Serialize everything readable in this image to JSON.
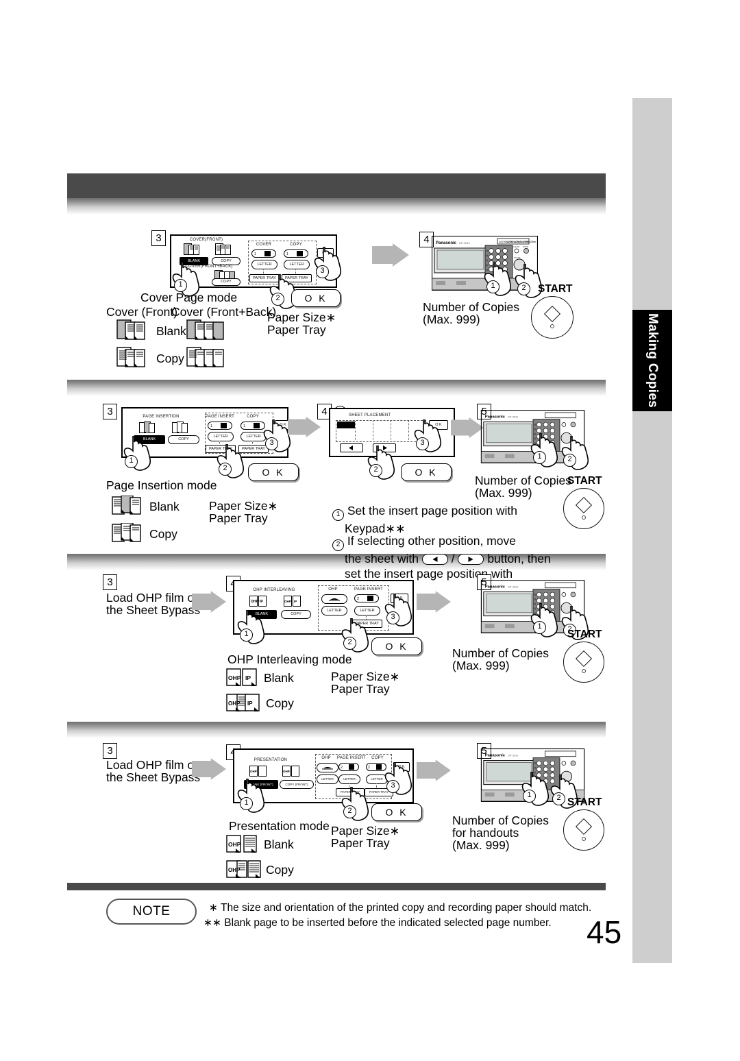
{
  "page": {
    "number": "45",
    "side_tab": "Making Copies",
    "accent_dark": "#4a4a4a",
    "sidebar_gray": "#cecece"
  },
  "note": {
    "label": "NOTE",
    "lines": [
      "∗ The size and orientation of the printed copy and recording paper should match.",
      "∗∗ Blank page to be inserted before the indicated selected page number."
    ]
  },
  "common": {
    "ok_label": "O K",
    "start_label": "START",
    "number_of_copies": "Number of Copies",
    "max_copies": "(Max. 999)",
    "paper_size": "Paper Size∗",
    "paper_tray": "Paper Tray",
    "blank": "Blank",
    "copy": "Copy",
    "load_ohp_line1": "Load OHP film onto",
    "load_ohp_line2": "the Sheet Bypass",
    "panel": {
      "letter": "LETTER",
      "paper_tray_btn": "PAPER TRAY",
      "ok_small": "O K",
      "blank_btn": "BLANK",
      "copy_btn": "COPY",
      "one": "1",
      "two": "2"
    },
    "brand": "Panasonic"
  },
  "sections": [
    {
      "id": "cover-page",
      "mode_title": "Cover Page mode",
      "subhead_left": "Cover (Front)",
      "subhead_right": "Cover (Front+Back)",
      "steps": [
        "3",
        "4"
      ],
      "panel": {
        "group1_title": "COVER(FRONT)",
        "group2_title": "COVER(FRONT+BACK)",
        "col1": "COVER",
        "col2": "COPY",
        "col1_count": "1",
        "col2_count": "1"
      },
      "markers": [
        "1",
        "2",
        "3"
      ],
      "copier_markers": [
        "1",
        "2"
      ]
    },
    {
      "id": "page-insertion",
      "mode_title": "Page Insertion mode",
      "steps": [
        "3",
        "4",
        "5"
      ],
      "panel": {
        "group1_title": "PAGE INSERTION",
        "col1": "PAGE INSERT",
        "col2": "COPY",
        "col1_count": "1",
        "col2_count": "1"
      },
      "panel2_title": "SHEET PLACEMENT",
      "instructions": [
        {
          "num": "1",
          "text": "Set the insert page position with Keypad∗∗"
        },
        {
          "num": "2",
          "text": "If selecting other position, move the sheet with ◄ / ► button, then set the insert page position with Keypad"
        }
      ],
      "markers": [
        "1",
        "2",
        "3"
      ],
      "copier_markers": [
        "1",
        "2"
      ]
    },
    {
      "id": "ohp-interleaving",
      "mode_title": "OHP Interleaving mode",
      "steps": [
        "3",
        "4",
        "5"
      ],
      "panel": {
        "group1_title": "OHP INTERLEAVING",
        "col1": "OHP",
        "col2": "PAGE INSERT",
        "col2_count": "2"
      },
      "markers": [
        "1",
        "2",
        "3"
      ],
      "copier_markers": [
        "1",
        "2"
      ]
    },
    {
      "id": "presentation",
      "mode_title": "Presentation mode",
      "steps": [
        "3",
        "4",
        "5"
      ],
      "panel": {
        "group1_title": "PRESENTATION",
        "col1": "OHP",
        "col2": "PAGE INSERT",
        "col3": "COPY",
        "col2_count": "2",
        "col3_count": "2",
        "blank_btn": "BLANK (FRONT)",
        "copy_btn": "COPY (FRONT)"
      },
      "copies_line1": "Number of Copies",
      "copies_line2": "for handouts",
      "copies_line3": "(Max. 999)",
      "markers": [
        "1",
        "2",
        "3"
      ],
      "copier_markers": [
        "1",
        "2"
      ]
    }
  ]
}
